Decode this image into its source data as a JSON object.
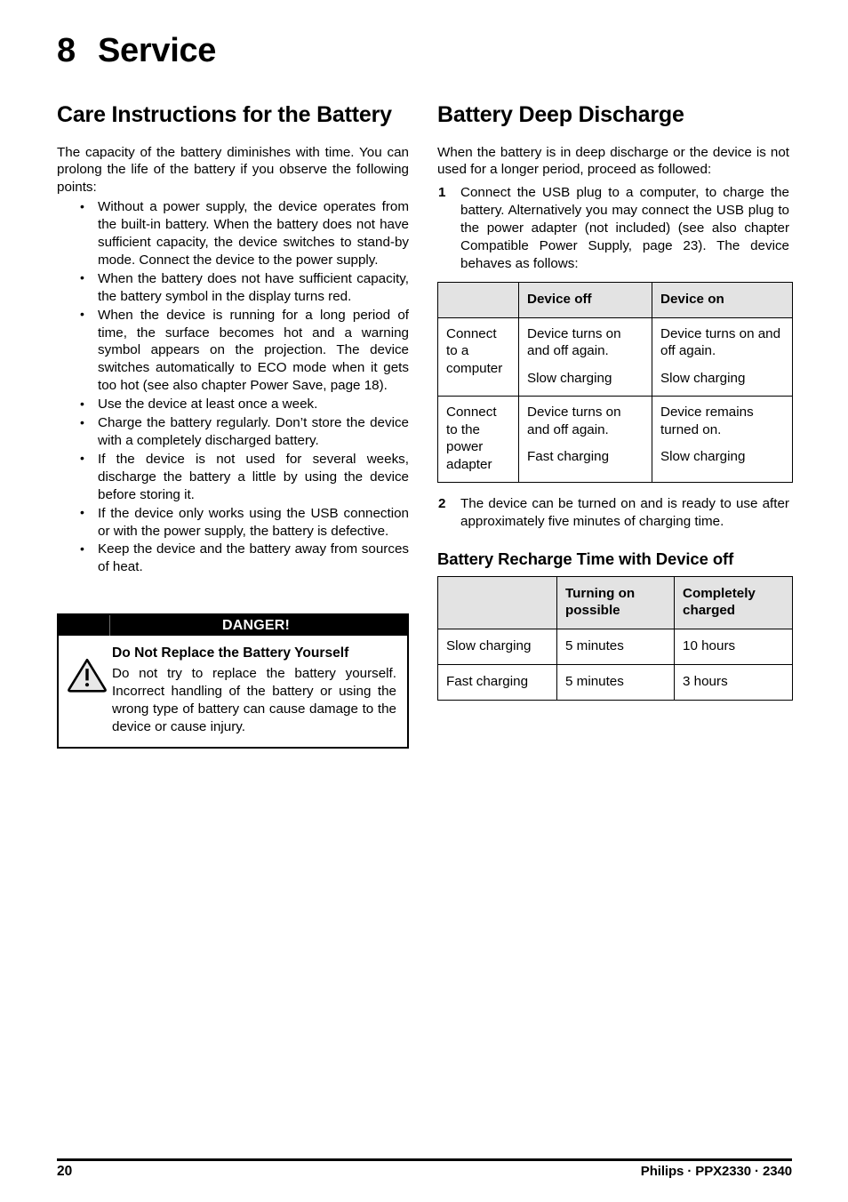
{
  "chapter": {
    "number": "8",
    "title": "Service"
  },
  "left_column": {
    "heading": "Care Instructions for the Battery",
    "intro": "The capacity of the battery diminishes with time. You can prolong the life of the battery if you observe the following points:",
    "bullets": [
      "Without a power supply, the device operates from the built-in battery. When the battery does not have sufficient capacity, the device switches to stand-by mode. Connect the device to the power supply.",
      "When the battery does not have sufficient capacity, the battery symbol in the display turns red.",
      "When the device is running for a long period of time, the surface becomes hot and a warning symbol appears on the projection. The device switches automatically to ECO mode when it gets too hot (see also chapter Power Save, page 18).",
      "Use the device at least once a week.",
      "Charge the battery regularly. Don’t store the device with a completely discharged battery.",
      "If the device is not used for several weeks, discharge the battery a little by using the device before storing it.",
      "If the device only works using the USB connection or with the power supply, the battery is defective.",
      "Keep the device and the battery away from sources of heat."
    ],
    "danger_box": {
      "bar_label": "DANGER!",
      "icon": "warning-triangle-icon",
      "heading": "Do Not Replace the Battery Yourself",
      "text": "Do not try to replace the battery yourself. Incorrect handling of the battery or using the wrong type of battery can cause damage to the device or cause injury."
    }
  },
  "right_column": {
    "heading": "Battery Deep Discharge",
    "intro": "When the battery is in deep discharge or the device is not used for a longer period, proceed as followed:",
    "steps": [
      {
        "number": "1",
        "text": "Connect the USB plug to a computer, to charge the battery. Alternatively you may connect the USB plug to the power adapter (not included) (see also chapter Compatible Power Supply, page 23). The device behaves as follows:"
      },
      {
        "number": "2",
        "text": "The device can be turned on and is ready to use after approximately five minutes of charging time."
      }
    ],
    "table_deep_discharge": {
      "headers": [
        "",
        "Device off",
        "Device on"
      ],
      "rows": [
        {
          "label": "Connect to a computer",
          "device_off": [
            "Device turns on and off again.",
            "Slow charging"
          ],
          "device_on": [
            "Device turns on and off again.",
            "Slow charging"
          ]
        },
        {
          "label": "Connect to the power adapter",
          "device_off": [
            "Device turns on and off again.",
            "Fast charging"
          ],
          "device_on": [
            "Device remains turned on.",
            "Slow charging"
          ]
        }
      ]
    },
    "recharge_heading": "Battery Recharge Time with Device off",
    "table_recharge": {
      "headers": [
        "",
        "Turning on possible",
        "Completely charged"
      ],
      "rows": [
        [
          "Slow charging",
          "5 minutes",
          "10 hours"
        ],
        [
          "Fast charging",
          "5 minutes",
          "3 hours"
        ]
      ]
    }
  },
  "footer": {
    "page_number": "20",
    "brand": "Philips · PPX2330 · 2340"
  }
}
